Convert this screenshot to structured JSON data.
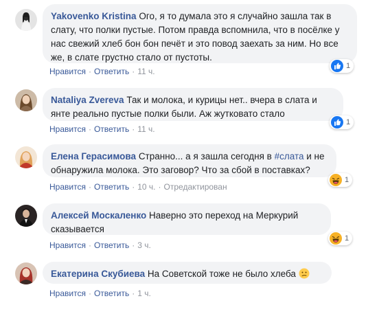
{
  "comments": [
    {
      "author": "Yakovenko Kristina",
      "text": "Ого, я то думала это я случайно зашла так в слату, что полки пустые. Потом правда вспомнила, что в посёлке у нас свежий хлеб бон бон печёт и это повод заехать за ним. Но все же, в слате грустно стало от пустоты.",
      "like_label": "Нравится",
      "reply_label": "Ответить",
      "time": "11 ч.",
      "reaction_icon": "like-icon",
      "reaction_count": "1",
      "colors": {
        "avatar_bg": "#d9d9d9"
      }
    },
    {
      "author": "Nataliya Zvereva",
      "text": "Так и молока, и курицы нет.. вчера в слата и янте реально пустые полки были. Аж жутковато стало",
      "like_label": "Нравится",
      "reply_label": "Ответить",
      "time": "11 ч.",
      "reaction_icon": "like-icon",
      "reaction_count": "1",
      "colors": {
        "avatar_bg": "#c9b8a3"
      }
    },
    {
      "author": "Елена Герасимова",
      "text_before": "Странно... а я зашла сегодня в ",
      "hashtag": "#слата",
      "text_after": " и не обнаружила молока. Это заговор? Что за сбой в поставках?",
      "like_label": "Нравится",
      "reply_label": "Ответить",
      "time": "10 ч.",
      "edited": "Отредактирован",
      "reaction_icon": "haha-icon",
      "reaction_count": "1",
      "colors": {
        "avatar_bg": "#e8c9a4"
      }
    },
    {
      "author": "Алексей Москаленко",
      "text": "Наверно это переход на Меркурий сказывается",
      "like_label": "Нравится",
      "reply_label": "Ответить",
      "time": "3 ч.",
      "reaction_icon": "haha-icon",
      "reaction_count": "1",
      "colors": {
        "avatar_bg": "#3a3030"
      }
    },
    {
      "author": "Екатерина Скубиева",
      "text": "На Советской тоже не было хлеба",
      "inline_emoji": "confused-face-icon",
      "like_label": "Нравится",
      "reply_label": "Ответить",
      "time": "1 ч.",
      "colors": {
        "avatar_bg": "#b23a2e"
      }
    }
  ],
  "colors": {
    "author_link": "#385898",
    "bubble_bg": "#f2f3f5",
    "like_blue": "#1877f2",
    "haha_yellow": "#f7b125"
  }
}
